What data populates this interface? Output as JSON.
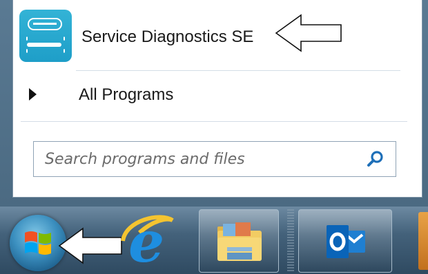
{
  "start_menu": {
    "pinned_program": {
      "label": "Service Diagnostics SE",
      "icon": "service-diagnostics-icon"
    },
    "all_programs": {
      "label": "All Programs",
      "icon": "triangle-right-icon"
    },
    "search": {
      "placeholder": "Search programs and files",
      "value": "",
      "icon": "search-icon"
    }
  },
  "taskbar": {
    "start_button": {
      "icon": "windows-start-orb-icon"
    },
    "pinned": [
      {
        "name": "internet-explorer",
        "icon": "internet-explorer-icon"
      },
      {
        "name": "windows-explorer",
        "icon": "folder-icon"
      },
      {
        "name": "outlook",
        "icon": "outlook-icon"
      }
    ]
  },
  "colors": {
    "taskbar": "#3d5b74",
    "app_icon": "#1e9ec8",
    "outlook_blue": "#0a64b8",
    "search_icon": "#1e6fb8"
  }
}
